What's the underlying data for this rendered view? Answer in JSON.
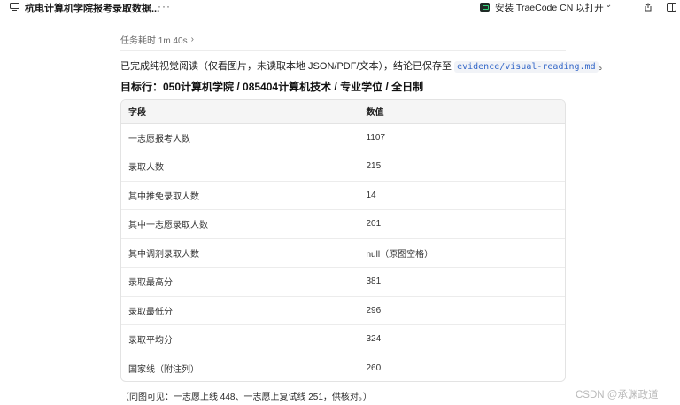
{
  "window": {
    "title": "杭电计算机学院报考录取数据..."
  },
  "toolbar": {
    "install_label": "安装 TraeCode CN 以打开"
  },
  "task": {
    "duration_label": "任务耗时 1m 40s"
  },
  "message": {
    "intro_prefix": "已完成纯视觉阅读（仅看图片，未读取本地 JSON/PDF/文本），结论已保存至 ",
    "file_path": "evidence/visual-reading.md",
    "intro_suffix": "。",
    "target_row": "目标行：050计算机学院 / 085404计算机技术 / 专业学位 / 全日制"
  },
  "table": {
    "headers": [
      "字段",
      "数值"
    ],
    "rows": [
      {
        "field": "一志愿报考人数",
        "value": "1107"
      },
      {
        "field": "录取人数",
        "value": "215"
      },
      {
        "field": "其中推免录取人数",
        "value": "14"
      },
      {
        "field": "其中一志愿录取人数",
        "value": "201"
      },
      {
        "field": "其中调剂录取人数",
        "value": "null（原图空格）"
      },
      {
        "field": "录取最高分",
        "value": "381"
      },
      {
        "field": "录取最低分",
        "value": "296"
      },
      {
        "field": "录取平均分",
        "value": "324"
      },
      {
        "field": "国家线（附注列）",
        "value": "260"
      }
    ]
  },
  "footnote": "（同图可见：一志愿上线 448、一志愿上复试线 251，供核对。）",
  "watermark": "CSDN @承渊政道"
}
